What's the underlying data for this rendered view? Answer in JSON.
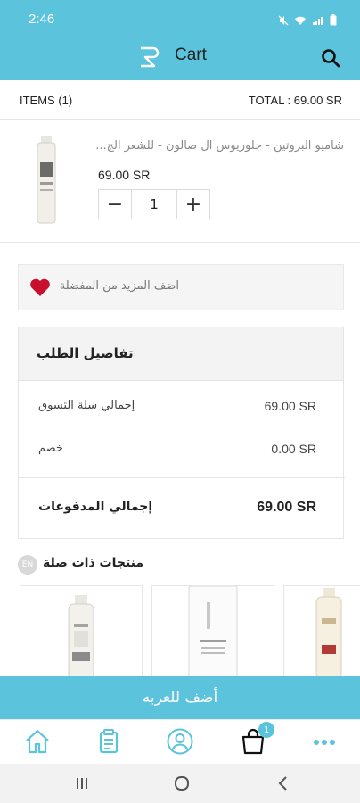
{
  "status_bar": {
    "time": "2:46"
  },
  "header": {
    "title": "Cart"
  },
  "summary": {
    "items_label": "ITEMS (1)",
    "total_label": "TOTAL : 69.00 SR"
  },
  "cart_item": {
    "name": "شاميو البروتين - جلوريوس ال صالون - للشعر الج...",
    "price": "69.00 SR",
    "quantity": "1"
  },
  "wishlist": {
    "text": "اضف المزيد من المفضلة"
  },
  "order": {
    "title": "تفاصيل الطلب",
    "subtotal_label": "إجمالي سلة التسوق",
    "subtotal_value": "69.00 SR",
    "discount_label": "خصم",
    "discount_value": "0.00 SR",
    "grand_label": "إجمالي المدفوعات",
    "grand_value": "69.00 SR"
  },
  "related": {
    "title": "منتجات ذات صلة",
    "icon_text": "EN"
  },
  "add_to_cart": {
    "label": "أضف للعربه"
  },
  "bottom_nav": {
    "cart_badge": "1"
  },
  "colors": {
    "accent": "#5bc3dc",
    "heart": "#c8102e"
  }
}
